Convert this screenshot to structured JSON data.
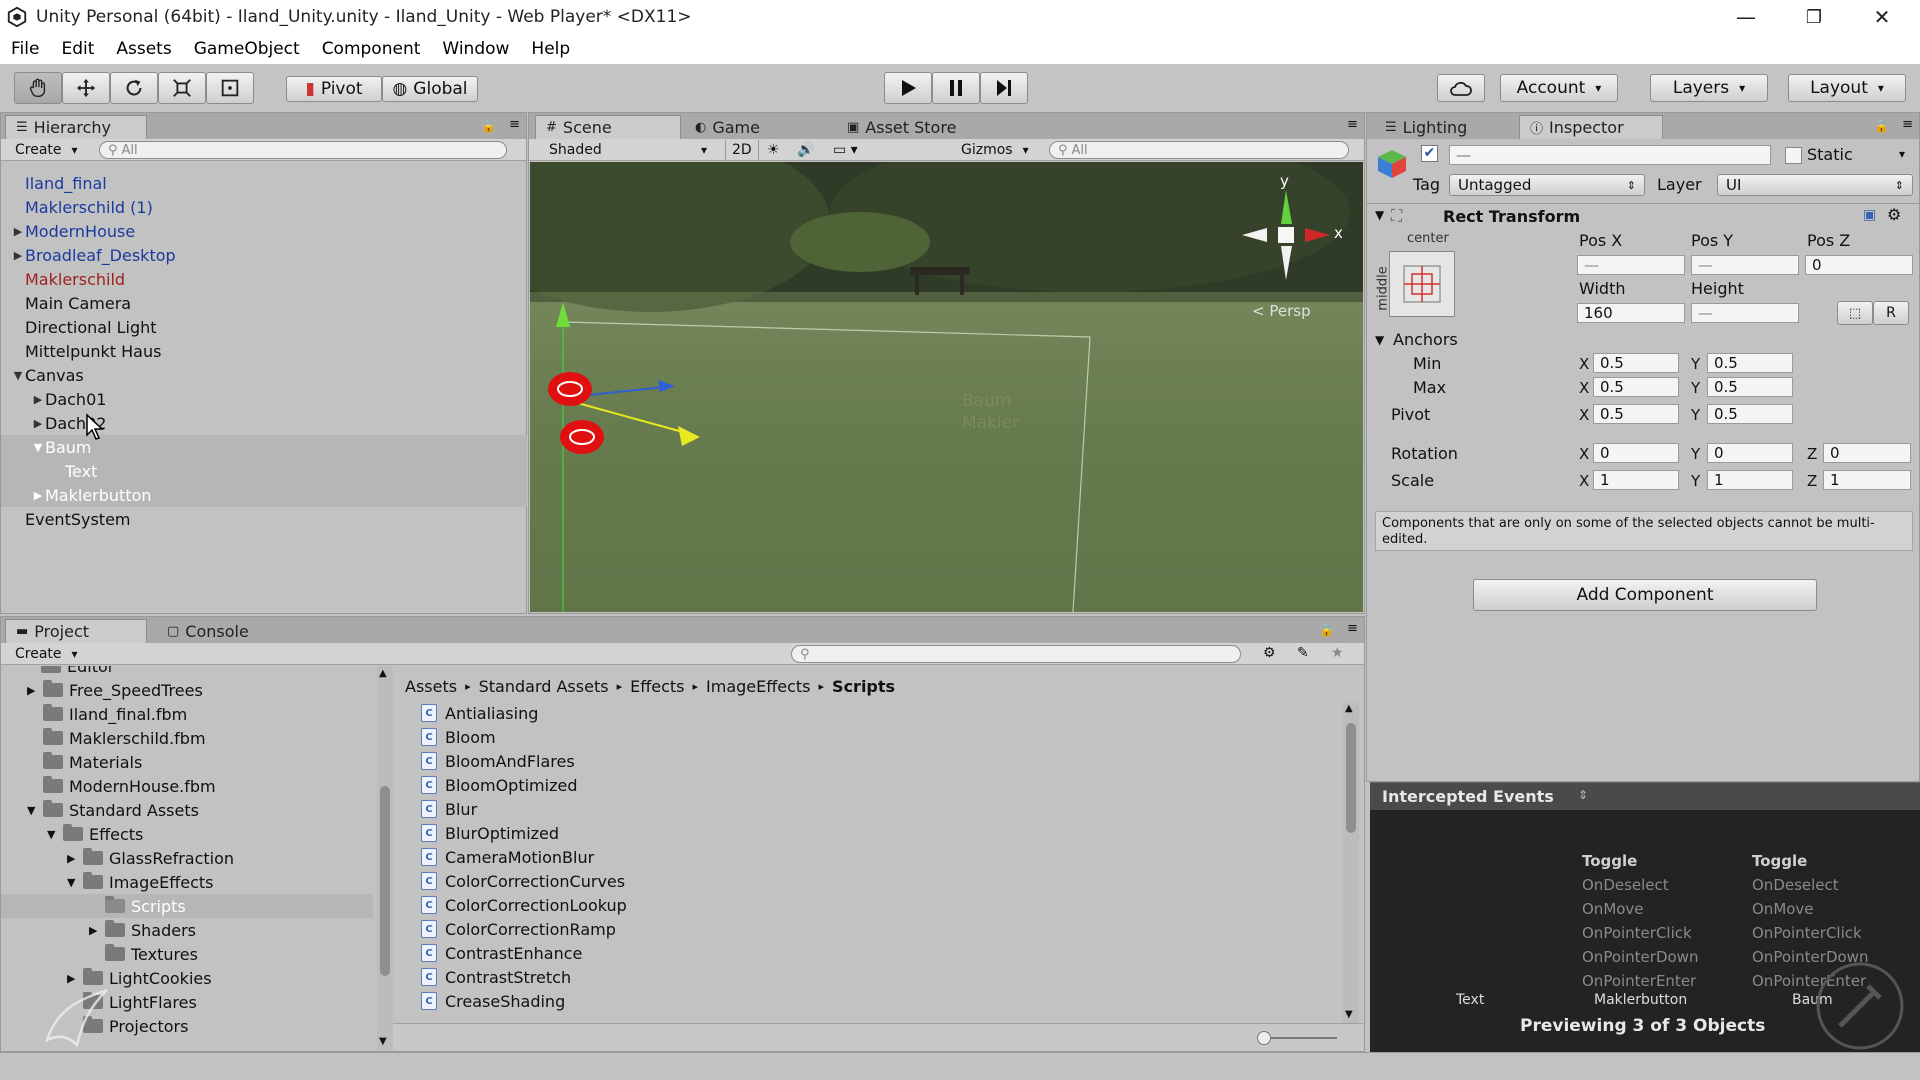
{
  "window": {
    "title": "Unity Personal (64bit) - Iland_Unity.unity - Iland_Unity - Web Player* <DX11>"
  },
  "menu": [
    "File",
    "Edit",
    "Assets",
    "GameObject",
    "Component",
    "Window",
    "Help"
  ],
  "toolbar": {
    "pivot": "Pivot",
    "global": "Global",
    "account": "Account",
    "layers": "Layers",
    "layout": "Layout"
  },
  "hierarchy": {
    "tab": "Hierarchy",
    "create": "Create",
    "search_placeholder": "All",
    "items": [
      {
        "label": "Iland_final"
      },
      {
        "label": "Maklerschild (1)"
      },
      {
        "label": "ModernHouse"
      },
      {
        "label": "Broadleaf_Desktop"
      },
      {
        "label": "Maklerschild"
      },
      {
        "label": "Main Camera"
      },
      {
        "label": "Directional Light"
      },
      {
        "label": "Mittelpunkt Haus"
      },
      {
        "label": "Canvas"
      },
      {
        "label": "Dach01"
      },
      {
        "label": "Dach02"
      },
      {
        "label": "Baum"
      },
      {
        "label": "Text"
      },
      {
        "label": "Maklerbutton"
      },
      {
        "label": "EventSystem"
      }
    ]
  },
  "scene": {
    "tabs": [
      "Scene",
      "Game",
      "Asset Store"
    ],
    "shading": "Shaded",
    "mode2d": "2D",
    "gizmos": "Gizmos",
    "search_placeholder": "All",
    "persp": "Persp",
    "axis_y": "y",
    "axis_x": "x",
    "overlay_label": "Baum\nMakler"
  },
  "inspector": {
    "tabs": [
      "Lighting",
      "Inspector"
    ],
    "static_label": "Static",
    "name_value": "—",
    "tag_label": "Tag",
    "tag_value": "Untagged",
    "layer_label": "Layer",
    "layer_value": "UI",
    "component_title": "Rect Transform",
    "anchor_preset_h": "center",
    "anchor_preset_v": "middle",
    "posx_label": "Pos X",
    "posy_label": "Pos Y",
    "posz_label": "Pos Z",
    "posx": "—",
    "posy": "—",
    "posz": "0",
    "width_label": "Width",
    "height_label": "Height",
    "width": "160",
    "height": "—",
    "r_button": "R",
    "anchors_label": "Anchors",
    "min_label": "Min",
    "max_label": "Max",
    "pivot_label": "Pivot",
    "rotation_label": "Rotation",
    "scale_label": "Scale",
    "axis_x": "X",
    "axis_y": "Y",
    "axis_z": "Z",
    "anchor_min_x": "0.5",
    "anchor_min_y": "0.5",
    "anchor_max_x": "0.5",
    "anchor_max_y": "0.5",
    "pivot_x": "0.5",
    "pivot_y": "0.5",
    "rot_x": "0",
    "rot_y": "0",
    "rot_z": "0",
    "scale_x": "1",
    "scale_y": "1",
    "scale_z": "1",
    "note": "Components that are only on some of the selected objects cannot be multi-edited.",
    "add_component": "Add Component"
  },
  "events": {
    "title": "Intercepted Events",
    "col1": [
      "Toggle",
      "OnDeselect",
      "OnMove",
      "OnPointerClick",
      "OnPointerDown",
      "OnPointerEnter"
    ],
    "col2": [
      "Toggle",
      "OnDeselect",
      "OnMove",
      "OnPointerClick",
      "OnPointerDown",
      "OnPointerEnter"
    ],
    "objects": [
      "Text",
      "Maklerbutton",
      "Baum"
    ],
    "preview": "Previewing 3 of 3 Objects"
  },
  "project": {
    "tabs": [
      "Project",
      "Console"
    ],
    "create": "Create",
    "tree": [
      {
        "label": "Editor"
      },
      {
        "label": "Free_SpeedTrees"
      },
      {
        "label": "Iland_final.fbm"
      },
      {
        "label": "Maklerschild.fbm"
      },
      {
        "label": "Materials"
      },
      {
        "label": "ModernHouse.fbm"
      },
      {
        "label": "Standard Assets"
      },
      {
        "label": "Effects"
      },
      {
        "label": "GlassRefraction"
      },
      {
        "label": "ImageEffects"
      },
      {
        "label": "Scripts"
      },
      {
        "label": "Shaders"
      },
      {
        "label": "Textures"
      },
      {
        "label": "LightCookies"
      },
      {
        "label": "LightFlares"
      },
      {
        "label": "Projectors"
      }
    ],
    "breadcrumb": [
      "Assets",
      "Standard Assets",
      "Effects",
      "ImageEffects",
      "Scripts"
    ],
    "scripts": [
      "Antialiasing",
      "Bloom",
      "BloomAndFlares",
      "BloomOptimized",
      "Blur",
      "BlurOptimized",
      "CameraMotionBlur",
      "ColorCorrectionCurves",
      "ColorCorrectionLookup",
      "ColorCorrectionRamp",
      "ContrastEnhance",
      "ContrastStretch",
      "CreaseShading"
    ]
  },
  "colors": {
    "prefab_blue": "#1a3a9e",
    "prefab_broken": "#a02020",
    "panel_bg": "#c2c2c2",
    "events_bg": "#232323"
  }
}
